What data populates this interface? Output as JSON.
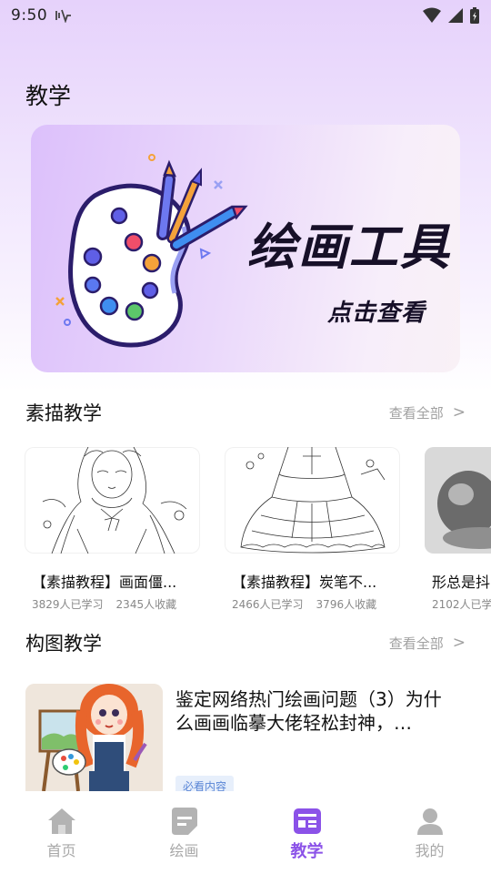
{
  "status_bar": {
    "time": "9:50"
  },
  "page": {
    "title": "教学"
  },
  "banner": {
    "title": "绘画工具",
    "subtitle": "点击查看"
  },
  "sketch": {
    "title": "素描教学",
    "more": "查看全部",
    "more_icon": ">",
    "cards": [
      {
        "title": "【素描教程】画面僵...",
        "learners": "3829人已学习",
        "favorites": "2345人收藏"
      },
      {
        "title": "【素描教程】炭笔不...",
        "learners": "2466人已学习",
        "favorites": "3796人收藏"
      },
      {
        "title": "形总是抖",
        "learners": "2102人已学",
        "favorites": ""
      }
    ]
  },
  "composition": {
    "title": "构图教学",
    "more": "查看全部",
    "more_icon": ">",
    "item": {
      "title": "鉴定网络热门绘画问题（3）为什么画画临摹大佬轻松封神，…",
      "badge": "必看内容"
    }
  },
  "tabbar": {
    "active_color": "#8b52e8",
    "items": [
      {
        "label": "首页",
        "icon": "home-icon"
      },
      {
        "label": "绘画",
        "icon": "paint-doc-icon"
      },
      {
        "label": "教学",
        "icon": "teach-icon"
      },
      {
        "label": "我的",
        "icon": "person-icon"
      }
    ]
  }
}
